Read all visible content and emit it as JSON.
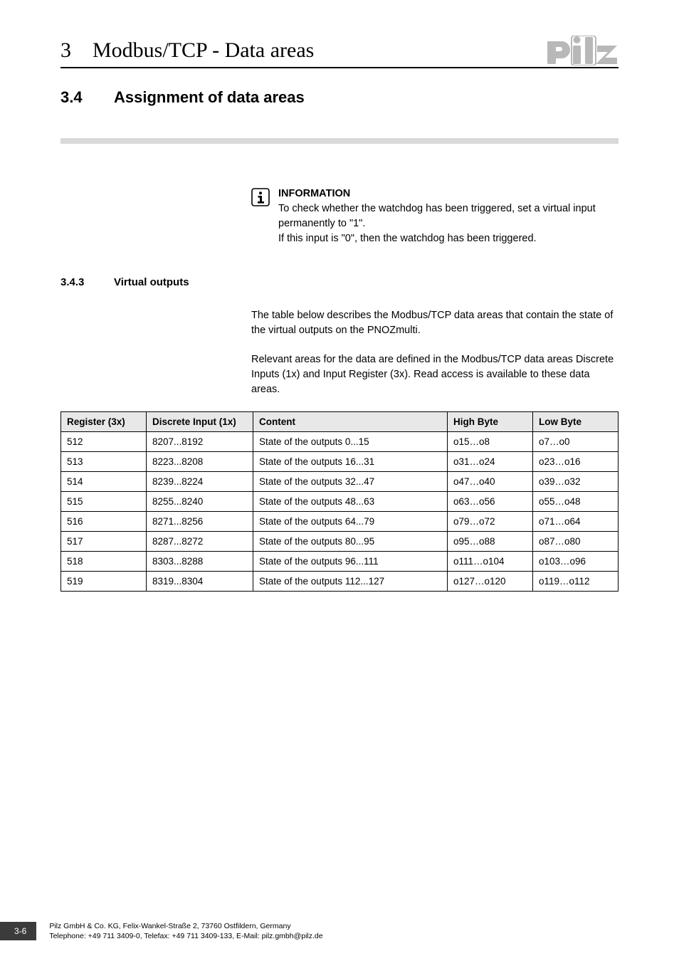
{
  "header": {
    "chapter_num": "3",
    "chapter_title": "Modbus/TCP - Data areas",
    "logo_text": "pilz"
  },
  "section": {
    "num": "3.4",
    "title": "Assignment of data areas"
  },
  "info": {
    "label": "INFORMATION",
    "line1": "To check whether the watchdog has been triggered, set a virtual input permanently to \"1\".",
    "line2": "If this input is \"0\", then the watchdog has been triggered."
  },
  "subsection": {
    "num": "3.4.3",
    "title": "Virtual outputs"
  },
  "paragraphs": {
    "p1": "The table below describes the Modbus/TCP data areas that contain the state of the virtual outputs on the PNOZmulti.",
    "p2": "Relevant areas for the data are defined in the Modbus/TCP data areas Discrete Inputs (1x) and Input Register (3x). Read access is available to these data areas."
  },
  "table": {
    "headers": {
      "c0": "Register (3x)",
      "c1": "Discrete Input (1x)",
      "c2": "Content",
      "c3": "High Byte",
      "c4": "Low Byte"
    },
    "rows": [
      {
        "c0": "512",
        "c1": "8207...8192",
        "c2": "State of the outputs 0...15",
        "c3": "o15…o8",
        "c4": "o7…o0"
      },
      {
        "c0": "513",
        "c1": "8223...8208",
        "c2": "State of the outputs 16...31",
        "c3": "o31…o24",
        "c4": "o23…o16"
      },
      {
        "c0": "514",
        "c1": "8239...8224",
        "c2": "State of the outputs 32...47",
        "c3": "o47…o40",
        "c4": "o39…o32"
      },
      {
        "c0": "515",
        "c1": "8255...8240",
        "c2": "State of the outputs 48...63",
        "c3": "o63…o56",
        "c4": "o55…o48"
      },
      {
        "c0": "516",
        "c1": "8271...8256",
        "c2": "State of the outputs 64...79",
        "c3": "o79…o72",
        "c4": "o71…o64"
      },
      {
        "c0": "517",
        "c1": "8287...8272",
        "c2": "State of the outputs 80...95",
        "c3": "o95…o88",
        "c4": "o87…o80"
      },
      {
        "c0": "518",
        "c1": "8303...8288",
        "c2": "State of the outputs 96...111",
        "c3": "o111…o104",
        "c4": "o103…o96"
      },
      {
        "c0": "519",
        "c1": "8319...8304",
        "c2": "State of the outputs 112...127",
        "c3": "o127…o120",
        "c4": "o119…o112"
      }
    ]
  },
  "footer": {
    "page": "3-6",
    "line1": "Pilz GmbH & Co. KG, Felix-Wankel-Straße 2, 73760 Ostfildern, Germany",
    "line2": "Telephone: +49 711 3409-0, Telefax: +49 711 3409-133, E-Mail: pilz.gmbh@pilz.de"
  }
}
